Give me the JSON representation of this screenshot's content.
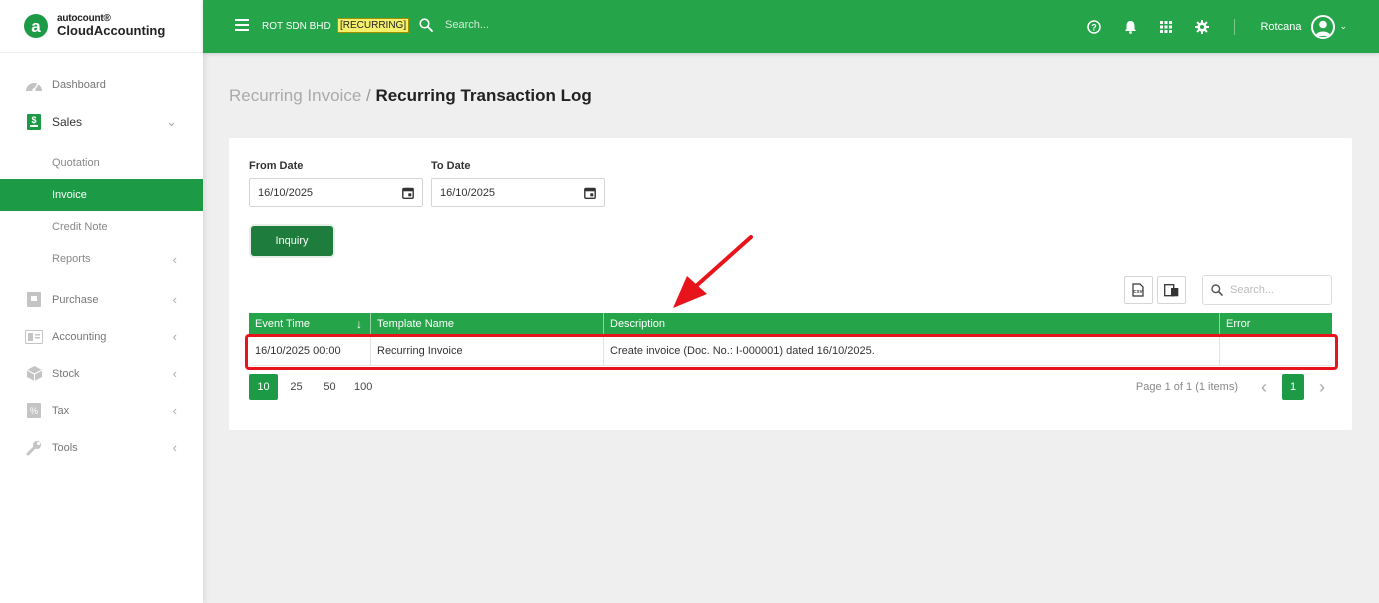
{
  "brand": {
    "line1": "autocount®",
    "line2": "CloudAccounting",
    "mark": "a"
  },
  "sidebar": {
    "items": [
      {
        "label": "Dashboard",
        "icon": "dashboard-icon",
        "chevron": ""
      },
      {
        "label": "Sales",
        "icon": "sales-icon",
        "chevron": "⌄"
      },
      {
        "label": "Purchase",
        "icon": "purchase-icon",
        "chevron": "‹"
      },
      {
        "label": "Accounting",
        "icon": "accounting-icon",
        "chevron": "‹"
      },
      {
        "label": "Stock",
        "icon": "stock-icon",
        "chevron": "‹"
      },
      {
        "label": "Tax",
        "icon": "tax-icon",
        "chevron": "‹"
      },
      {
        "label": "Tools",
        "icon": "tools-icon",
        "chevron": "‹"
      }
    ],
    "sales_sub": [
      {
        "label": "Quotation"
      },
      {
        "label": "Invoice"
      },
      {
        "label": "Credit Note"
      },
      {
        "label": "Reports",
        "chevron": "‹"
      }
    ]
  },
  "topbar": {
    "company": "ROT SDN BHD",
    "badge": "[RECURRING]",
    "search_placeholder": "Search...",
    "username": "Rotcana",
    "caret": "⌄"
  },
  "breadcrumb": {
    "parent": "Recurring Invoice",
    "sep": " / ",
    "current": "Recurring Transaction Log"
  },
  "filters": {
    "from_label": "From Date",
    "from_value": "16/10/2025",
    "to_label": "To Date",
    "to_value": "16/10/2025",
    "inquiry_label": "Inquiry"
  },
  "grid": {
    "search_placeholder": "Search...",
    "columns": [
      "Event Time",
      "Template Name",
      "Description",
      "Error"
    ],
    "sort_indicator": "↓",
    "rows": [
      [
        "16/10/2025 00:00",
        "Recurring Invoice",
        "Create invoice (Doc. No.: I-000001) dated 16/10/2025.",
        ""
      ]
    ],
    "page_sizes": [
      "10",
      "25",
      "50",
      "100"
    ],
    "page_info": "Page 1 of 1 (1 items)",
    "current_page": "1",
    "prev": "‹",
    "next": "›"
  },
  "colors": {
    "brand_green": "#26a449",
    "dark_green": "#1e7d3c",
    "highlight_red": "#e8141c",
    "badge_yellow": "#f5f06a"
  }
}
